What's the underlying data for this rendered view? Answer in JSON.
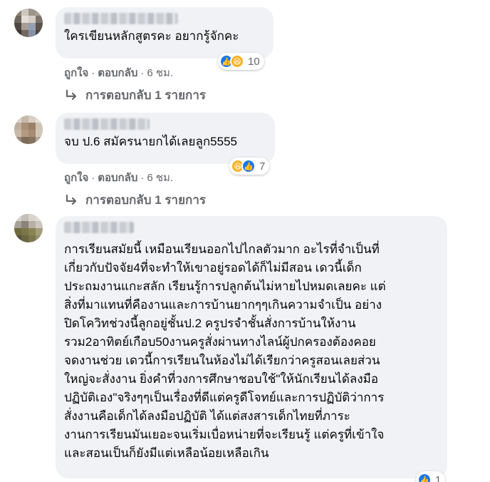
{
  "comments": [
    {
      "author": "[blurred name]",
      "text_lines": [
        "ใครเขียนหลักสูตรคะ อยากรู้จักคะ"
      ],
      "reactions": {
        "icons": [
          "like-icon",
          "haha-icon"
        ],
        "count": "10"
      },
      "actions": {
        "like": "ถูกใจ",
        "reply": "ตอบกลับ",
        "time": "6 ชม."
      },
      "replies_label": "การตอบกลับ 1 รายการ"
    },
    {
      "author": "[blurred name]",
      "text_lines": [
        "จบ ป.6 สมัครนายกได้เลยลูก5555"
      ],
      "reactions": {
        "icons": [
          "haha-icon",
          "like-icon"
        ],
        "count": "7"
      },
      "actions": {
        "like": "ถูกใจ",
        "reply": "ตอบกลับ",
        "time": "6 ชม."
      },
      "replies_label": "การตอบกลับ 1 รายการ"
    },
    {
      "author": "[blurred name]",
      "text_lines": [
        "การเรียนสมัยนี้ เหมือนเรียนออกไปไกลตัวมาก อะไรที่จำเป็นที่",
        "เกี่ยวกับปัจจัย4ที่จะทำให้เขาอยู่รอดได้ก็ไม่มีสอน เดวนี้เด็ก",
        "ประถมงานแกะสลัก เรียนรู้การปลูกต้นไม่หายไปหมดเลยคะ แต่",
        "สิ่งที่มาแทนที่คืองานและการบ้านยากๆๆเกินความจำเป็น อย่าง",
        "ปิดโควิทช่วงนี้ลูกอยู่ชั้นป.2 ครูปรจำชั้นสั่งการบ้านให้งาน",
        "รวม2อาทิตย์เกือบ50งานครูสั่งผ่านทางไลน์ผู้ปกครองต้องคอย",
        "จดงานช่วย เดวนี้การเรียนในห้องไม่ได้เรียกว่าครูสอนเลยส่วน",
        "ใหญ่จะสั่งงาน ยิ่งคำที่วงการศึกษาชอบใช้\"ให้นักเรียนได้ลงมือ",
        "ปฏิบัติเอง\"จริงๆๆเป็นเรื่องที่ดีแต่ครูดีโจทย์และการปฏิบัติว่าการ",
        "สั่งงานคือเด็กได้ลงมือปฏิบัติ ได้แต่สงสารเด็กไทยที่ภาระ",
        "งานการเรียนมันเยอะจนเริ่มเบื่อหน่ายที่จะเรียนรู้ แต่ครูที่เข้าใจ",
        "และสอนเป็นก็ยังมีแต่เหลือน้อยเหลือเกิน"
      ],
      "reactions": {
        "icons": [
          "like-icon"
        ],
        "count": "1"
      }
    }
  ]
}
